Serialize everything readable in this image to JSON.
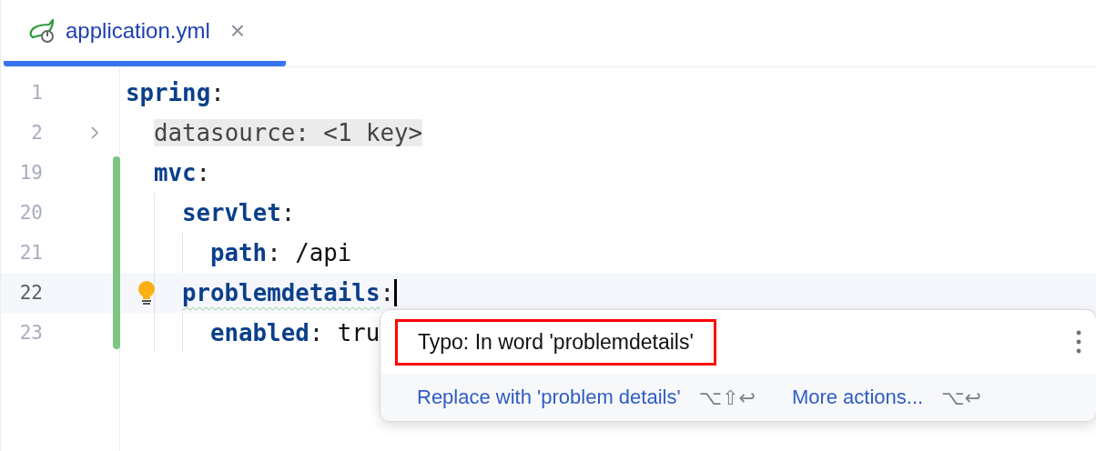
{
  "tabs": [
    {
      "label": "application.yml",
      "selected": true,
      "close": "×"
    }
  ],
  "editor": {
    "lines": [
      {
        "number": "1",
        "key": "spring",
        "colon": ":",
        "children": [
          {
            "number": "2",
            "folded": true,
            "placeholder": "datasource: <1 key>"
          },
          {
            "number": "19",
            "key": "mvc",
            "colon": ":",
            "changed": true,
            "children": [
              {
                "number": "20",
                "key": "servlet",
                "colon": ":",
                "changed": true,
                "children": [
                  {
                    "number": "21",
                    "key": "path",
                    "colon": ":",
                    "value": "/api",
                    "changed": true
                  }
                ]
              },
              {
                "number": "22",
                "key": "problemdetails",
                "colon": ":",
                "changed": true,
                "typo": true,
                "current": true,
                "children": [
                  {
                    "number": "23",
                    "key": "enabled",
                    "colon": ":",
                    "value": "tru",
                    "changed": true
                  }
                ]
              }
            ]
          }
        ]
      }
    ]
  },
  "popup": {
    "title": "Typo: In word 'problemdetails'",
    "highlighted": true,
    "actions": [
      {
        "label": "Replace with 'problem details'",
        "shortcut": "⌥⇧↩"
      },
      {
        "label": "More actions...",
        "shortcut": "⌥↩"
      }
    ]
  }
}
